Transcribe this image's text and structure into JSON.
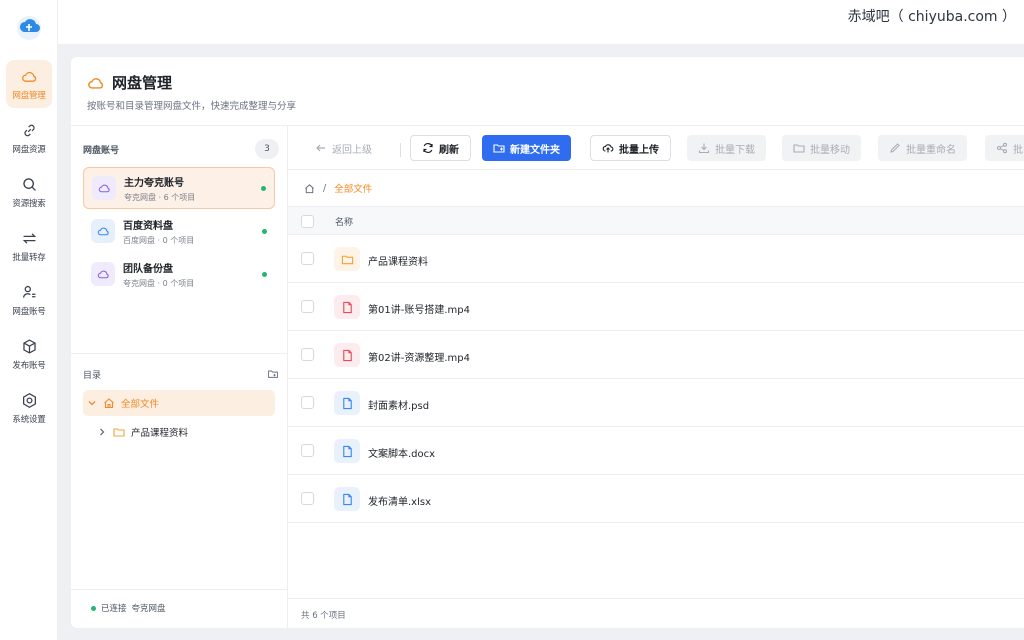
{
  "brand": {
    "text": "赤域吧（ chiyuba.com ）"
  },
  "nav": {
    "items": [
      {
        "label": "网盘管理",
        "icon": "cloud-icon",
        "active": true
      },
      {
        "label": "网盘资源",
        "icon": "link-icon",
        "active": false
      },
      {
        "label": "资源搜索",
        "icon": "search-icon",
        "active": false
      },
      {
        "label": "批量转存",
        "icon": "transfer-icon",
        "active": false
      },
      {
        "label": "网盘账号",
        "icon": "user-list-icon",
        "active": false
      },
      {
        "label": "发布账号",
        "icon": "box-icon",
        "active": false
      },
      {
        "label": "系统设置",
        "icon": "settings-icon",
        "active": false
      }
    ]
  },
  "page": {
    "title": "网盘管理",
    "subtitle": "按账号和目录管理网盘文件，快速完成整理与分享"
  },
  "accounts": {
    "title": "网盘账号",
    "count": "3",
    "items": [
      {
        "name": "主力夸克账号",
        "meta": "夸克网盘 · 6 个项目",
        "color": "purple",
        "active": true,
        "status_color": "#22b573"
      },
      {
        "name": "百度资料盘",
        "meta": "百度网盘 · 0 个项目",
        "color": "blue",
        "active": false,
        "status_color": "#22b573"
      },
      {
        "name": "团队备份盘",
        "meta": "夸克网盘 · 0 个项目",
        "color": "purple",
        "active": false,
        "status_color": "#22b573"
      }
    ]
  },
  "directory": {
    "title": "目录",
    "tree": [
      {
        "label": "全部文件",
        "expanded": true,
        "active": true,
        "icon": "home-icon"
      },
      {
        "label": "产品课程资料",
        "expanded": false,
        "active": false,
        "icon": "folder-icon"
      }
    ]
  },
  "connection": {
    "status": "已连接",
    "drive": "夸克网盘"
  },
  "toolbar": {
    "back": "返回上级",
    "refresh": "刷新",
    "new_folder": "新建文件夹",
    "upload": "批量上传",
    "download": "批量下载",
    "move": "批量移动",
    "rename": "批量重命名",
    "share": "批"
  },
  "breadcrumb": {
    "current": "全部文件"
  },
  "table": {
    "header_name": "名称",
    "rows": [
      {
        "name": "产品课程资料",
        "type": "folder"
      },
      {
        "name": "第01讲-账号搭建.mp4",
        "type": "video"
      },
      {
        "name": "第02讲-资源整理.mp4",
        "type": "video"
      },
      {
        "name": "封面素材.psd",
        "type": "doc"
      },
      {
        "name": "文案脚本.docx",
        "type": "doc"
      },
      {
        "name": "发布清单.xlsx",
        "type": "doc"
      }
    ],
    "footer": "共 6 个项目"
  },
  "colors": {
    "accent": "#f08a24",
    "primary": "#2f6cf0",
    "success": "#22b573"
  }
}
